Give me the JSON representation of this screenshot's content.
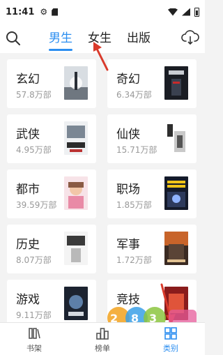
{
  "status_bar": {
    "time": "11:41",
    "icons": [
      "gear-icon",
      "sd-card-icon",
      "wifi-icon",
      "signal-icon",
      "battery-icon"
    ]
  },
  "header": {
    "tabs": [
      {
        "label": "男生",
        "active": true
      },
      {
        "label": "女生",
        "active": false
      },
      {
        "label": "出版",
        "active": false
      }
    ],
    "accent_color": "#2b8ef0"
  },
  "categories": [
    {
      "name": "玄幻",
      "count": "57.8万部"
    },
    {
      "name": "奇幻",
      "count": "6.34万部"
    },
    {
      "name": "武侠",
      "count": "4.95万部"
    },
    {
      "name": "仙侠",
      "count": "15.71万部"
    },
    {
      "name": "都市",
      "count": "39.59万部"
    },
    {
      "name": "职场",
      "count": "1.85万部"
    },
    {
      "name": "历史",
      "count": "8.07万部"
    },
    {
      "name": "军事",
      "count": "1.72万部"
    },
    {
      "name": "游戏",
      "count": "9.11万部"
    },
    {
      "name": "竞技",
      "count": ""
    }
  ],
  "bottom_nav": [
    {
      "label": "书架",
      "active": false
    },
    {
      "label": "榜单",
      "active": false
    },
    {
      "label": "类别",
      "active": true
    }
  ]
}
